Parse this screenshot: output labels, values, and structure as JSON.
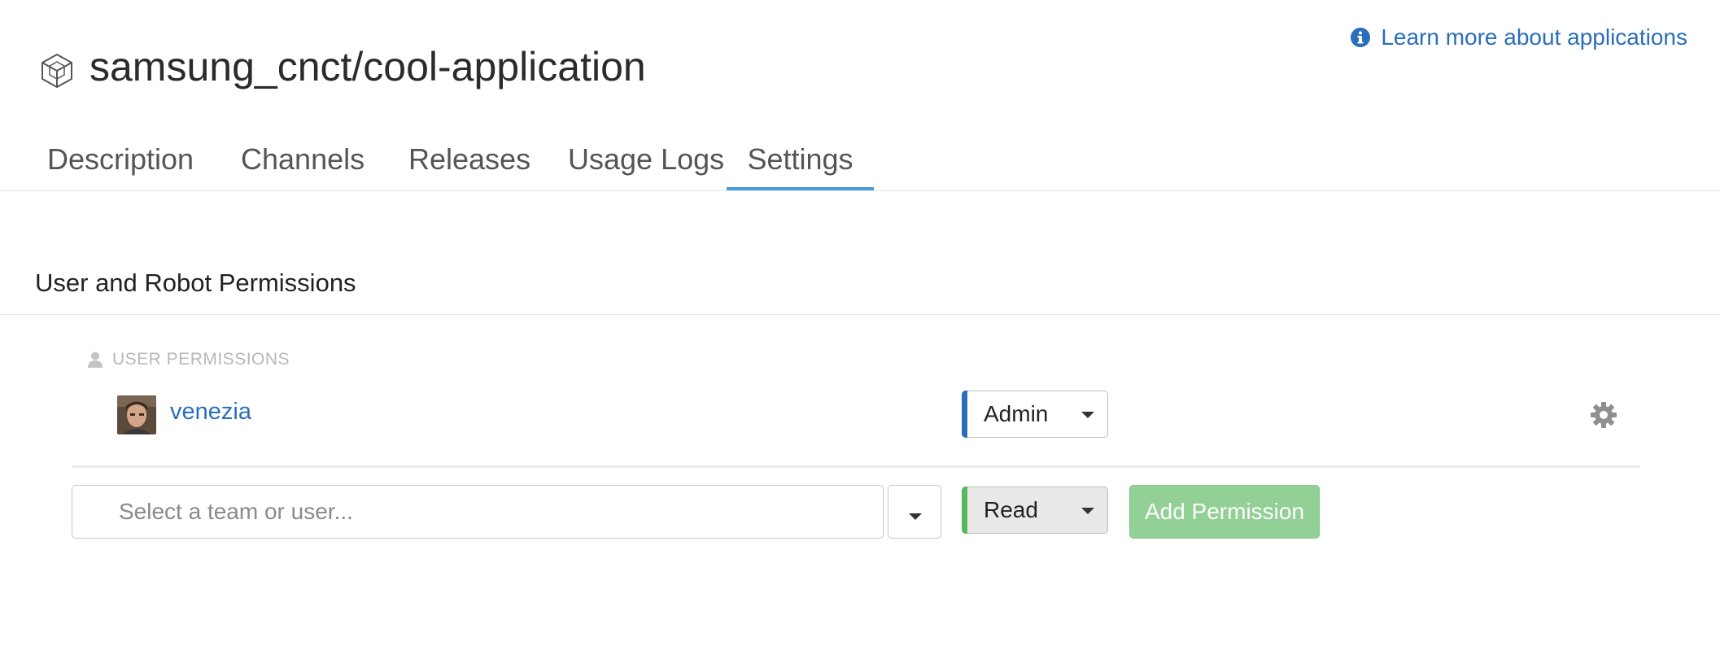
{
  "header": {
    "title": "samsung_cnct/cool-application",
    "app_icon": "cube-icon",
    "learn_more": {
      "icon": "info-icon",
      "label": "Learn more about applications"
    }
  },
  "tabs": [
    {
      "label": "Description",
      "active": false
    },
    {
      "label": "Channels",
      "active": false
    },
    {
      "label": "Releases",
      "active": false
    },
    {
      "label": "Usage Logs",
      "active": false
    },
    {
      "label": "Settings",
      "active": true
    }
  ],
  "permissions": {
    "section_title": "User and Robot Permissions",
    "user_header": {
      "icon": "user-icon",
      "label": "USER PERMISSIONS"
    },
    "entries": [
      {
        "username": "venezia",
        "avatar": "avatar-photo",
        "role": "Admin",
        "settings_icon": "gear-icon"
      }
    ],
    "add_row": {
      "placeholder": "Select a team or user...",
      "role": "Read",
      "button_label": "Add Permission"
    }
  },
  "colors": {
    "link": "#2a6ebb",
    "active_tab": "#4a9bd8",
    "admin_bar": "#2a6ebb",
    "read_bar": "#58b85c",
    "add_button": "#92d095"
  }
}
